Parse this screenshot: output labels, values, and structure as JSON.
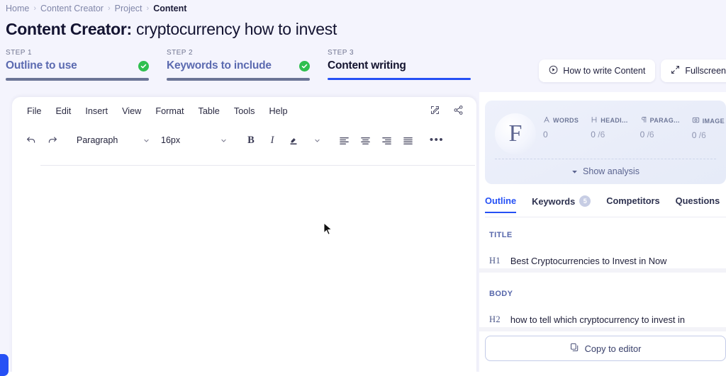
{
  "breadcrumb": {
    "items": [
      "Home",
      "Content Creator",
      "Project",
      "Content"
    ],
    "separator": "›"
  },
  "page_title": {
    "lead": "Content Creator:",
    "keyword": "cryptocurrency how to invest"
  },
  "steps": [
    {
      "num": "STEP 1",
      "label": "Outline to use",
      "complete": true
    },
    {
      "num": "STEP 2",
      "label": "Keywords to include",
      "complete": true
    },
    {
      "num": "STEP 3",
      "label": "Content writing",
      "complete": false
    }
  ],
  "header_actions": [
    {
      "label": "How to write Content",
      "icon": "play-circle-icon"
    },
    {
      "label": "Fullscreen",
      "icon": "expand-icon"
    }
  ],
  "editor": {
    "menu": [
      "File",
      "Edit",
      "Insert",
      "View",
      "Format",
      "Table",
      "Tools",
      "Help"
    ],
    "menu_right_icons": [
      "edit-pencil-icon",
      "share-icon"
    ],
    "toolbar": {
      "undo": "undo-icon",
      "redo": "redo-icon",
      "block_format": "Paragraph",
      "font_size": "16px",
      "bold": "B",
      "italic": "I",
      "highlight": "text-color-icon",
      "align_left": "align-left-icon",
      "align_center": "align-center-icon",
      "align_right": "align-right-icon",
      "align_justify": "align-justify-icon",
      "more": "•••"
    },
    "body_text": ""
  },
  "analysis": {
    "grade": "F",
    "metrics": [
      {
        "icon": "font-size-icon",
        "label": "WORDS",
        "value": "0",
        "denominator": ""
      },
      {
        "icon": "heading-icon",
        "label": "HEADI...",
        "value": "0",
        "denominator": "/6"
      },
      {
        "icon": "paragraph-icon",
        "label": "PARAG...",
        "value": "0",
        "denominator": "/6"
      },
      {
        "icon": "image-icon",
        "label": "IMAGE",
        "value": "0",
        "denominator": "/6"
      }
    ],
    "show_analysis": "Show analysis"
  },
  "panel_tabs": [
    {
      "label": "Outline",
      "badge": "",
      "active": true
    },
    {
      "label": "Keywords",
      "badge": "5",
      "active": false
    },
    {
      "label": "Competitors",
      "badge": "",
      "active": false
    },
    {
      "label": "Questions",
      "badge": "",
      "active": false
    }
  ],
  "outline": {
    "title_section": {
      "label": "TITLE",
      "rows": [
        {
          "tag": "H1",
          "text": "Best Cryptocurrencies to Invest in Now"
        }
      ]
    },
    "body_section": {
      "label": "BODY",
      "rows": [
        {
          "tag": "H2",
          "text": "how to tell which cryptocurrency to invest in"
        }
      ]
    }
  },
  "copy_button": {
    "label": "Copy to editor",
    "icon": "copy-icon"
  },
  "colors": {
    "background": "#f4f4fd",
    "accent_blue": "#2550f5",
    "step_link": "#5b6ab0",
    "complete_green": "#2fbf4f",
    "panel_white": "#ffffff",
    "muted_text": "#8086a9"
  }
}
